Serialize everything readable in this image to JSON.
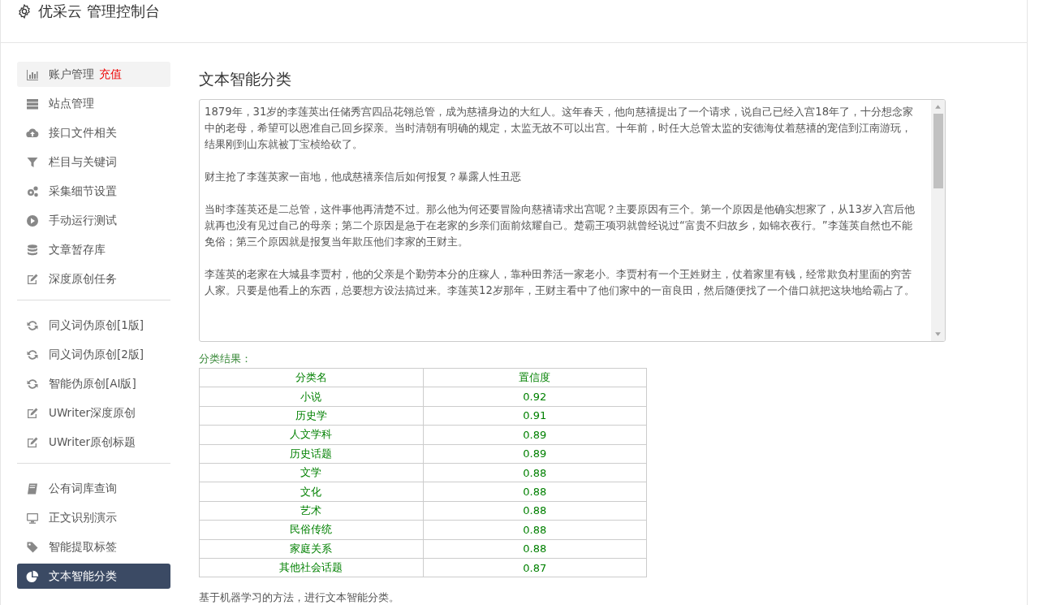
{
  "header": {
    "title": "优采云 管理控制台"
  },
  "sidebar": {
    "groups": [
      [
        {
          "label": "账户管理",
          "badge": "充值",
          "hovered": true,
          "selected": false
        },
        {
          "label": "站点管理",
          "hovered": false,
          "selected": false
        },
        {
          "label": "接口文件相关",
          "hovered": false,
          "selected": false
        },
        {
          "label": "栏目与关键词",
          "hovered": false,
          "selected": false
        },
        {
          "label": "采集细节设置",
          "hovered": false,
          "selected": false
        },
        {
          "label": "手动运行测试",
          "hovered": false,
          "selected": false
        },
        {
          "label": "文章暂存库",
          "hovered": false,
          "selected": false
        },
        {
          "label": "深度原创任务",
          "hovered": false,
          "selected": false
        }
      ],
      [
        {
          "label": "同义词伪原创[1版]",
          "hovered": false,
          "selected": false
        },
        {
          "label": "同义词伪原创[2版]",
          "hovered": false,
          "selected": false
        },
        {
          "label": "智能伪原创[AI版]",
          "hovered": false,
          "selected": false
        },
        {
          "label": "UWriter深度原创",
          "hovered": false,
          "selected": false
        },
        {
          "label": "UWriter原创标题",
          "hovered": false,
          "selected": false
        }
      ],
      [
        {
          "label": "公有词库查询",
          "hovered": false,
          "selected": false
        },
        {
          "label": "正文识别演示",
          "hovered": false,
          "selected": false
        },
        {
          "label": "智能提取标签",
          "hovered": false,
          "selected": false
        },
        {
          "label": "文本智能分类",
          "hovered": false,
          "selected": true
        }
      ]
    ]
  },
  "main": {
    "title": "文本智能分类",
    "text_area": {
      "paragraphs": [
        "1879年，31岁的李莲英出任储秀宫四品花翎总管，成为慈禧身边的大红人。这年春天，他向慈禧提出了一个请求，说自己已经入宫18年了，十分想念家中的老母，希望可以恩准自己回乡探亲。当时清朝有明确的规定，太监无故不可以出宫。十年前，时任大总管太监的安德海仗着慈禧的宠信到江南游玩，结果刚到山东就被丁宝桢给砍了。",
        "财主抢了李莲英家一亩地，他成慈禧亲信后如何报复？暴露人性丑恶",
        "当时李莲英还是二总管，这件事他再清楚不过。那么他为何还要冒险向慈禧请求出宫呢？主要原因有三个。第一个原因是他确实想家了，从13岁入宫后他就再也没有见过自己的母亲；第二个原因是急于在老家的乡亲们面前炫耀自己。楚霸王项羽就曾经说过“富贵不归故乡，如锦衣夜行。”李莲英自然也不能免俗；第三个原因就是报复当年欺压他们李家的王财主。",
        "李莲英的老家在大城县李贾村，他的父亲是个勤劳本分的庄稼人，靠种田养活一家老小。李贾村有一个王姓财主，仗着家里有钱，经常欺负村里面的穷苦人家。只要是他看上的东西，总要想方设法搞过来。李莲英12岁那年，王财主看中了他们家中的一亩良田，然后随便找了一个借口就把这块地给霸占了。"
      ]
    },
    "result_label": "分类结果：",
    "table": {
      "columns": [
        "分类名",
        "置信度"
      ],
      "rows": [
        [
          "小说",
          "0.92"
        ],
        [
          "历史学",
          "0.91"
        ],
        [
          "人文学科",
          "0.89"
        ],
        [
          "历史话题",
          "0.89"
        ],
        [
          "文学",
          "0.88"
        ],
        [
          "文化",
          "0.88"
        ],
        [
          "艺术",
          "0.88"
        ],
        [
          "民俗传统",
          "0.88"
        ],
        [
          "家庭关系",
          "0.88"
        ],
        [
          "其他社会话题",
          "0.87"
        ]
      ]
    },
    "note": "基于机器学习的方法，进行文本智能分类。"
  }
}
